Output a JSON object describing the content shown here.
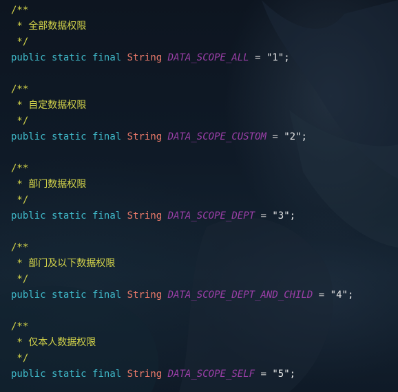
{
  "colors": {
    "background": "#0d1622",
    "comment": "#d4d44a",
    "keyword": "#3fb8c8",
    "type": "#ec7a6a",
    "constant": "#9b3fa8"
  },
  "blocks": [
    {
      "open": "/**",
      "comment": " * 全部数据权限",
      "close": " */",
      "kw_public": "public",
      "kw_static": "static",
      "kw_final": "final",
      "type": "String",
      "name": "DATA_SCOPE_ALL",
      "eq": " = ",
      "value": "\"1\"",
      "semi": ";"
    },
    {
      "open": "/**",
      "comment": " * 自定数据权限",
      "close": " */",
      "kw_public": "public",
      "kw_static": "static",
      "kw_final": "final",
      "type": "String",
      "name": "DATA_SCOPE_CUSTOM",
      "eq": " = ",
      "value": "\"2\"",
      "semi": ";"
    },
    {
      "open": "/**",
      "comment": " * 部门数据权限",
      "close": " */",
      "kw_public": "public",
      "kw_static": "static",
      "kw_final": "final",
      "type": "String",
      "name": "DATA_SCOPE_DEPT",
      "eq": " = ",
      "value": "\"3\"",
      "semi": ";"
    },
    {
      "open": "/**",
      "comment": " * 部门及以下数据权限",
      "close": " */",
      "kw_public": "public",
      "kw_static": "static",
      "kw_final": "final",
      "type": "String",
      "name": "DATA_SCOPE_DEPT_AND_CHILD",
      "eq": " = ",
      "value": "\"4\"",
      "semi": ";"
    },
    {
      "open": "/**",
      "comment": " * 仅本人数据权限",
      "close": " */",
      "kw_public": "public",
      "kw_static": "static",
      "kw_final": "final",
      "type": "String",
      "name": "DATA_SCOPE_SELF",
      "eq": " = ",
      "value": "\"5\"",
      "semi": ";"
    }
  ]
}
